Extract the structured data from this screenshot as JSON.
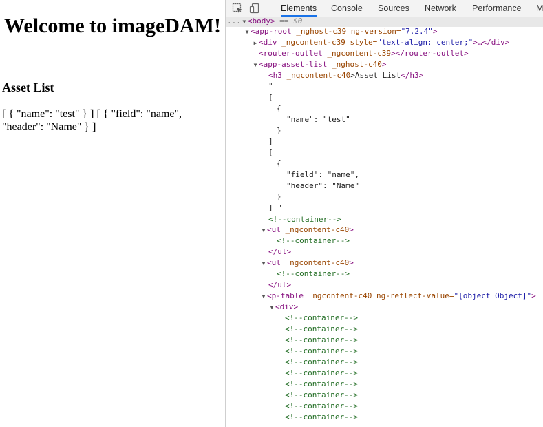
{
  "app": {
    "title": "Welcome to imageDAM!",
    "heading": "Asset List",
    "dump": "[ { \"name\": \"test\" } ] [ { \"field\": \"name\", \"header\": \"Name\" } ]"
  },
  "devtools": {
    "tabs": [
      {
        "label": "Elements",
        "active": true
      },
      {
        "label": "Console"
      },
      {
        "label": "Sources"
      },
      {
        "label": "Network"
      },
      {
        "label": "Performance"
      },
      {
        "label": "M"
      }
    ],
    "body": {
      "tag": "body",
      "ref": "== $0",
      "prefix": "..."
    },
    "app_root": {
      "open": "<app-root",
      "attrs": " _nghost-c39 ng-version=",
      "version": "\"7.2.4\"",
      "close": ">"
    },
    "div_row": {
      "open": "<div",
      "attrs": " _ngcontent-c39 style=",
      "style": "\"text-align: center;\"",
      "rest": ">…</div>"
    },
    "router_outlet": {
      "open": "<router-outlet",
      "attrs": " _ngcontent-c39",
      "close": "></router-outlet>"
    },
    "asset_list": {
      "open": "<app-asset-list",
      "attrs": " _nghost-c40",
      "close": ">"
    },
    "h3_row": {
      "open": "<h3",
      "attrs": " _ngcontent-c40",
      "text": ">Asset List",
      "close": "</h3>"
    },
    "text_lines": [
      "\"",
      "[",
      "{",
      "\"name\": \"test\"",
      "}",
      "]",
      "[",
      "{",
      "\"field\": \"name\",",
      "\"header\": \"Name\"",
      "}",
      "] \""
    ],
    "container_comment": "<!--container-->",
    "ul_open": {
      "open": "<ul",
      "attrs": " _ngcontent-c40",
      "close": ">"
    },
    "ul_close": "</ul>",
    "ptable": {
      "open": "<p-table",
      "attrs": " _ngcontent-c40 ng-reflect-value=",
      "value": "\"[object Object]\"",
      "close": ">"
    },
    "div_open": "<div>"
  }
}
